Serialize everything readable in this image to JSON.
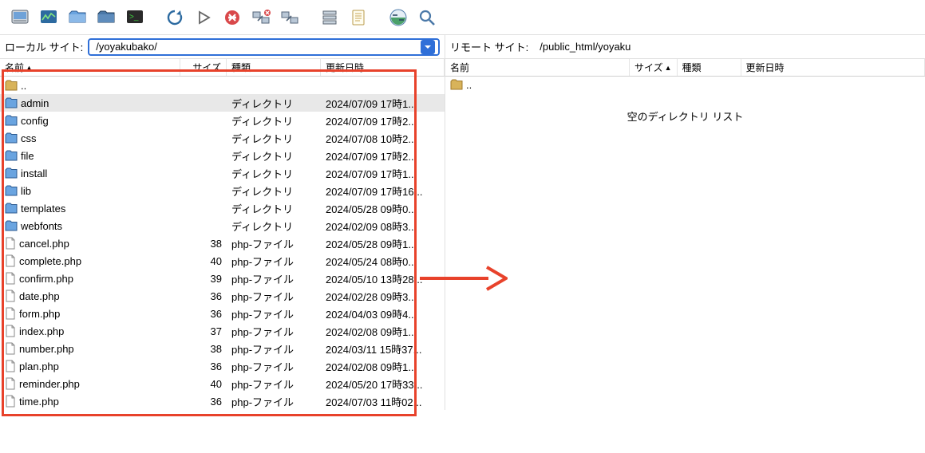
{
  "local": {
    "label": "ローカル サイト:",
    "path": "/yoyakubako/",
    "columns": {
      "name": "名前",
      "size": "サイズ",
      "type": "種類",
      "date": "更新日時"
    },
    "rows": [
      {
        "kind": "up",
        "name": "..",
        "size": "",
        "type": "",
        "date": ""
      },
      {
        "kind": "folder",
        "name": "admin",
        "size": "",
        "type": "ディレクトリ",
        "date": "2024/07/09 17時1...",
        "selected": true
      },
      {
        "kind": "folder",
        "name": "config",
        "size": "",
        "type": "ディレクトリ",
        "date": "2024/07/09 17時2..."
      },
      {
        "kind": "folder",
        "name": "css",
        "size": "",
        "type": "ディレクトリ",
        "date": "2024/07/08 10時2..."
      },
      {
        "kind": "folder",
        "name": "file",
        "size": "",
        "type": "ディレクトリ",
        "date": "2024/07/09 17時2..."
      },
      {
        "kind": "folder",
        "name": "install",
        "size": "",
        "type": "ディレクトリ",
        "date": "2024/07/09 17時1..."
      },
      {
        "kind": "folder",
        "name": "lib",
        "size": "",
        "type": "ディレクトリ",
        "date": "2024/07/09 17時16..."
      },
      {
        "kind": "folder",
        "name": "templates",
        "size": "",
        "type": "ディレクトリ",
        "date": "2024/05/28 09時0..."
      },
      {
        "kind": "folder",
        "name": "webfonts",
        "size": "",
        "type": "ディレクトリ",
        "date": "2024/02/09 08時3..."
      },
      {
        "kind": "file",
        "name": "cancel.php",
        "size": "38",
        "type": "php-ファイル",
        "date": "2024/05/28 09時1..."
      },
      {
        "kind": "file",
        "name": "complete.php",
        "size": "40",
        "type": "php-ファイル",
        "date": "2024/05/24 08時0..."
      },
      {
        "kind": "file",
        "name": "confirm.php",
        "size": "39",
        "type": "php-ファイル",
        "date": "2024/05/10 13時28..."
      },
      {
        "kind": "file",
        "name": "date.php",
        "size": "36",
        "type": "php-ファイル",
        "date": "2024/02/28 09時3..."
      },
      {
        "kind": "file",
        "name": "form.php",
        "size": "36",
        "type": "php-ファイル",
        "date": "2024/04/03 09時4..."
      },
      {
        "kind": "file",
        "name": "index.php",
        "size": "37",
        "type": "php-ファイル",
        "date": "2024/02/08 09時1..."
      },
      {
        "kind": "file",
        "name": "number.php",
        "size": "38",
        "type": "php-ファイル",
        "date": "2024/03/11 15時37..."
      },
      {
        "kind": "file",
        "name": "plan.php",
        "size": "36",
        "type": "php-ファイル",
        "date": "2024/02/08 09時1..."
      },
      {
        "kind": "file",
        "name": "reminder.php",
        "size": "40",
        "type": "php-ファイル",
        "date": "2024/05/20 17時33..."
      },
      {
        "kind": "file",
        "name": "time.php",
        "size": "36",
        "type": "php-ファイル",
        "date": "2024/07/03 11時02..."
      }
    ]
  },
  "remote": {
    "label": "リモート サイト:",
    "path": "/public_html/yoyaku",
    "columns": {
      "name": "名前",
      "size": "サイズ",
      "type": "種類",
      "date": "更新日時"
    },
    "up": "..",
    "empty_message": "空のディレクトリ リスト"
  },
  "toolbar_icons": [
    "site-manager-icon",
    "log-icon",
    "local-tree-icon",
    "remote-tree-icon",
    "terminal-icon",
    "gap",
    "refresh-icon",
    "run-icon",
    "stop-icon",
    "disconnect-icon",
    "reconnect-icon",
    "gap",
    "queue-icon",
    "filter-icon",
    "gap",
    "compare-icon",
    "search-icon"
  ]
}
